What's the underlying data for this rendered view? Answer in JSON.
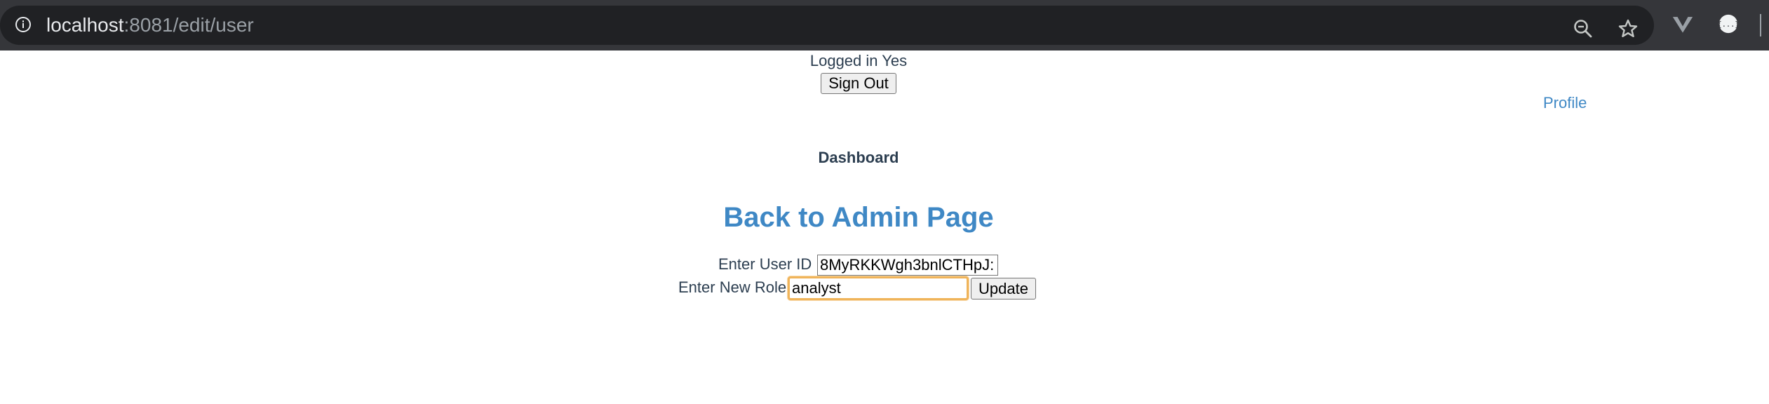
{
  "browser": {
    "url_host": "localhost",
    "url_path": ":8081/edit/user",
    "icons": [
      "info-icon",
      "zoom-icon",
      "star-icon",
      "vue-devtools-icon",
      "extension-icon"
    ]
  },
  "header": {
    "logged_in_text": "Logged in Yes",
    "sign_out_label": "Sign Out",
    "profile_link": "Profile"
  },
  "nav": {
    "dashboard_label": "Dashboard"
  },
  "main": {
    "back_link": "Back to Admin Page",
    "user_id_label": "Enter User ID",
    "user_id_value": "8MyRKKWgh3bnlCTHpJ:",
    "role_label": "Enter New Role",
    "role_value": "analyst",
    "update_label": "Update"
  },
  "colors": {
    "link": "#3f88c5",
    "text": "#2c3e50",
    "focus_ring": "#f0b45a"
  }
}
